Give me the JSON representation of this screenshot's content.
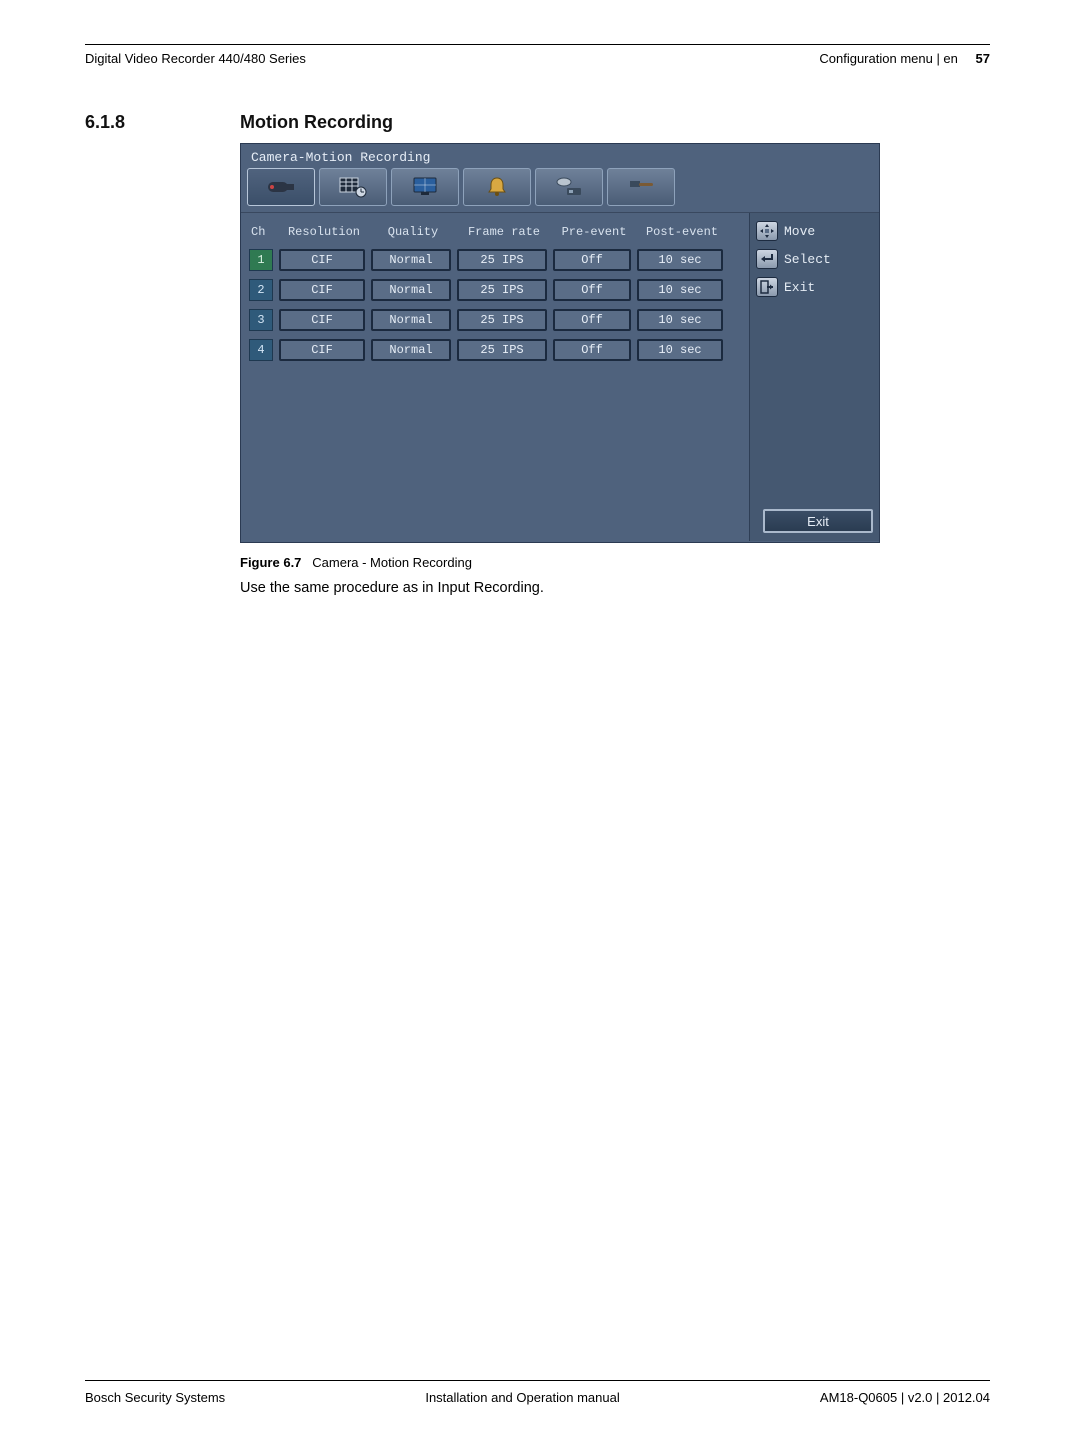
{
  "header": {
    "left": "Digital Video Recorder 440/480 Series",
    "right": "Configuration menu | en",
    "page": "57"
  },
  "section": {
    "number": "6.1.8",
    "title": "Motion Recording"
  },
  "screenshot": {
    "title": "Camera-Motion Recording",
    "columns": {
      "ch": "Ch",
      "resolution": "Resolution",
      "quality": "Quality",
      "frame_rate": "Frame rate",
      "pre_event": "Pre-event",
      "post_event": "Post-event"
    },
    "rows": [
      {
        "ch": "1",
        "resolution": "CIF",
        "quality": "Normal",
        "frame_rate": "25 IPS",
        "pre_event": "Off",
        "post_event": "10 sec"
      },
      {
        "ch": "2",
        "resolution": "CIF",
        "quality": "Normal",
        "frame_rate": "25 IPS",
        "pre_event": "Off",
        "post_event": "10 sec"
      },
      {
        "ch": "3",
        "resolution": "CIF",
        "quality": "Normal",
        "frame_rate": "25 IPS",
        "pre_event": "Off",
        "post_event": "10 sec"
      },
      {
        "ch": "4",
        "resolution": "CIF",
        "quality": "Normal",
        "frame_rate": "25 IPS",
        "pre_event": "Off",
        "post_event": "10 sec"
      }
    ],
    "legend": {
      "move": "Move",
      "select": "Select",
      "exit": "Exit"
    },
    "exit_button": "Exit"
  },
  "figure": {
    "label": "Figure 6.7",
    "caption": "Camera - Motion Recording"
  },
  "body_text": "Use the same procedure as in Input Recording.",
  "footer": {
    "left": "Bosch Security Systems",
    "center": "Installation and Operation manual",
    "right": "AM18-Q0605 | v2.0 | 2012.04"
  }
}
